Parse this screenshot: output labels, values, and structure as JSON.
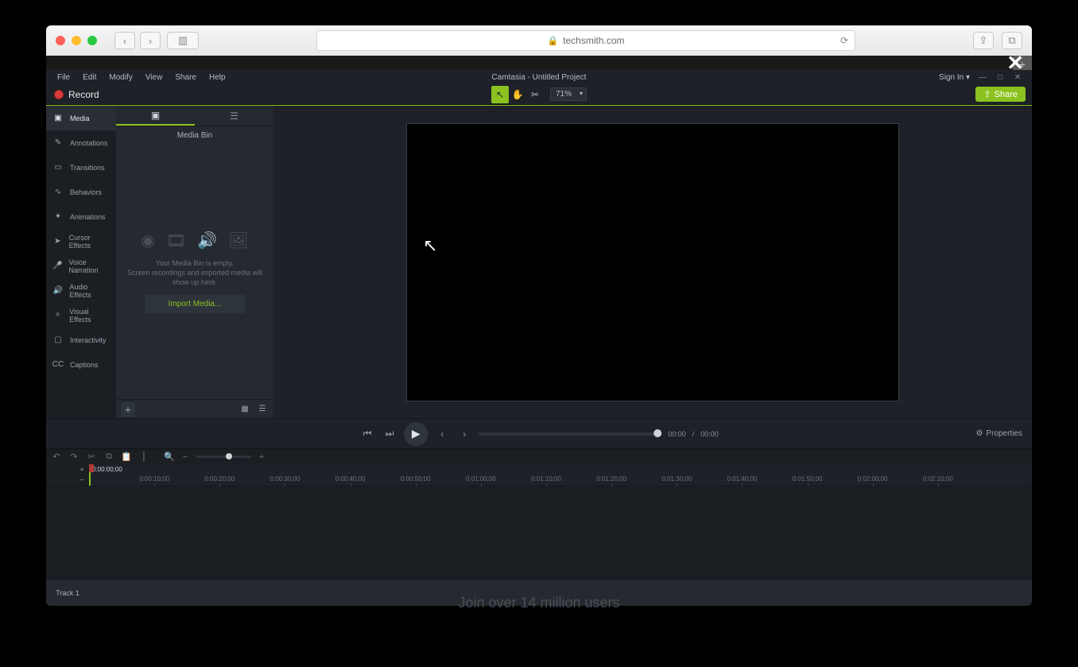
{
  "browser": {
    "url_host": "techsmith.com",
    "actions": {
      "share": "􀈂",
      "tabs": "􀐅"
    }
  },
  "close_x": "✕",
  "app": {
    "menu": [
      "File",
      "Edit",
      "Modify",
      "View",
      "Share",
      "Help"
    ],
    "title": "Camtasia - Untitled Project",
    "signin": "Sign In",
    "record": "Record",
    "zoom": "71%",
    "share": "Share",
    "sidebar": [
      {
        "label": "Media",
        "icon": "▣"
      },
      {
        "label": "Annotations",
        "icon": "✎"
      },
      {
        "label": "Transitions",
        "icon": "▭"
      },
      {
        "label": "Behaviors",
        "icon": "∿"
      },
      {
        "label": "Animations",
        "icon": "✦"
      },
      {
        "label": "Cursor Effects",
        "icon": "➤"
      },
      {
        "label": "Voice Narration",
        "icon": "🎤"
      },
      {
        "label": "Audio Effects",
        "icon": "🔊"
      },
      {
        "label": "Visual Effects",
        "icon": "✧"
      },
      {
        "label": "Interactivity",
        "icon": "▢"
      },
      {
        "label": "Captions",
        "icon": "CC"
      }
    ],
    "bin": {
      "title": "Media Bin",
      "empty1": "Your Media Bin is empty.",
      "empty2": "Screen recordings and imported media will show up here.",
      "import": "Import Media..."
    },
    "playback": {
      "cur": "00:00",
      "sep": "/",
      "dur": "00:00",
      "properties": "Properties"
    },
    "timeline": {
      "playhead_time": "0:00:00;00",
      "ticks": [
        "0:00:10;00",
        "0:00:20;00",
        "0:00:30;00",
        "0:00:40;00",
        "0:00:50;00",
        "0:01:00;00",
        "0:01:10;00",
        "0:01:20;00",
        "0:01:30;00",
        "0:01:40;00",
        "0:01:50;00",
        "0:02:00;00",
        "0:02:10;00"
      ],
      "track": "Track 1"
    }
  },
  "bg_text": "Join over 14 million users"
}
